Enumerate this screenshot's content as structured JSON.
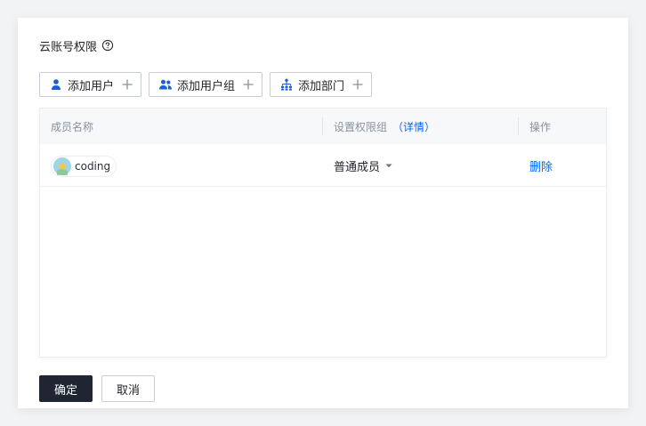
{
  "dialog": {
    "title": "云账号权限",
    "help_icon": "question-circle-icon"
  },
  "actions": [
    {
      "label": "添加用户",
      "icon": "user-icon"
    },
    {
      "label": "添加用户组",
      "icon": "user-group-icon"
    },
    {
      "label": "添加部门",
      "icon": "department-icon"
    }
  ],
  "table": {
    "columns": {
      "member": "成员名称",
      "role": "设置权限组",
      "role_detail": "（详情）",
      "operation": "操作"
    },
    "rows": [
      {
        "name": "coding",
        "role": "普通成员",
        "action": "删除"
      }
    ]
  },
  "footer": {
    "confirm": "确定",
    "cancel": "取消"
  },
  "colors": {
    "primary": "#1f2632",
    "link": "#0066ff",
    "icon": "#1a5fd6"
  }
}
